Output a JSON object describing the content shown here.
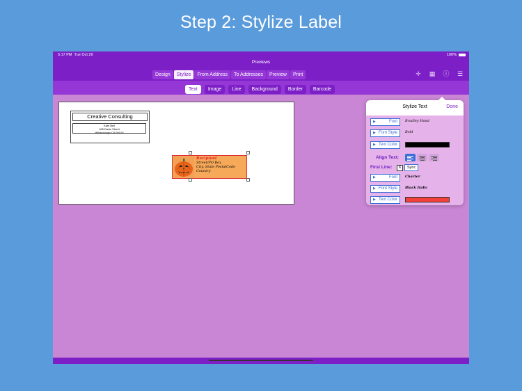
{
  "headline": "Step 2: Stylize Label",
  "status": {
    "time": "5:17 PM",
    "date": "Tue Oct 29",
    "battery": "100%"
  },
  "window_title": "Previews",
  "main_tabs": [
    "Design",
    "Stylize",
    "From Address",
    "To Addresses",
    "Preview",
    "Print"
  ],
  "main_tabs_active": "Stylize",
  "toolbar_icons": [
    "move-icon",
    "grid-icon",
    "help-icon",
    "list-icon"
  ],
  "sub_tabs": [
    "Text",
    "Image",
    "Line",
    "Background",
    "Border",
    "Barcode"
  ],
  "sub_tabs_active": "Text",
  "label": {
    "return_title": "Creative Consulting",
    "return_lines": [
      "Kate Bell",
      "165 Davis Street",
      "Hillsborough CA 94010"
    ],
    "recipient_lines": [
      "Recipient",
      "Street/PO Box",
      "City, State PostalCode",
      "Country"
    ]
  },
  "panel": {
    "title": "Stylize Text",
    "done": "Done",
    "font_label": "Font",
    "font_value": "Bradley Hand",
    "font_style_label": "Font Style",
    "font_style_value": "Bold",
    "text_color_label": "Text Color",
    "text_color_value": "#000000",
    "align_label": "Align Text:",
    "align_selected": "left",
    "first_line_label": "First Line:",
    "first_line_checkbox": "X",
    "sync_label": "Sync",
    "first_font_label": "Font",
    "first_font_value": "Charter",
    "first_font_style_label": "Font Style",
    "first_font_style_value": "Black Italic",
    "first_text_color_label": "Text Color",
    "first_text_color_value": "#f2403a"
  },
  "colors": {
    "accent": "#7d1fc7",
    "canvas_bg": "#c986d4",
    "outer_bg": "#5a9bdc",
    "button_blue": "#3c6fd6"
  }
}
